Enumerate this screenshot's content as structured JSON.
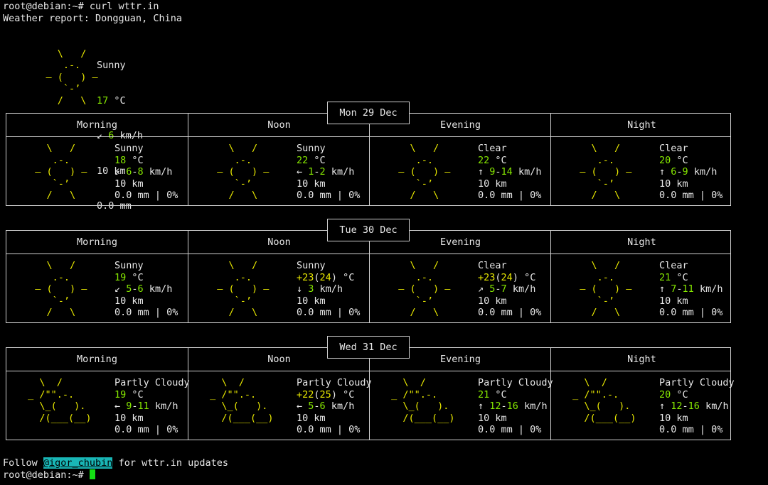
{
  "terminal": {
    "prompt_command": "root@debian:~# curl wttr.in",
    "report_title": "Weather report: Dongguan, China",
    "follow_prefix": "Follow ",
    "follow_handle": "@igor_chubin",
    "follow_suffix": " for wttr.in updates",
    "final_prompt": "root@debian:~# "
  },
  "art": {
    "sunny": [
      "    \\   /    ",
      "     .-.     ",
      "  ― (   ) ―  ",
      "     `-’     ",
      "    /   \\    "
    ],
    "partly_cloudy": [
      "   \\  /      ",
      " _ /\"\".-.    ",
      "   \\_(   ).  ",
      "   /(___(__) ",
      "             "
    ]
  },
  "current": {
    "condition": "Sunny",
    "temp_value": "17",
    "temp_unit": " °C",
    "wind_arrow": "↙ ",
    "wind_value": "6",
    "wind_unit": " km/h",
    "visibility": "10 km",
    "precip": "0.0 mm"
  },
  "periods": [
    "Morning",
    "Noon",
    "Evening",
    "Night"
  ],
  "days": [
    {
      "date": "Mon 29 Dec",
      "cells": [
        {
          "art": "sunny",
          "condition": "Sunny",
          "temp_pre": "",
          "temp_main": "18",
          "temp_mid": "",
          "temp_paren": "",
          "temp_post": "",
          "temp_unit": " °C",
          "wind_arrow": "↙ ",
          "wind_a": "6",
          "wind_sep": "-",
          "wind_b": "8",
          "wind_unit": " km/h",
          "visibility": "10 km",
          "precip": "0.0 mm | 0%"
        },
        {
          "art": "sunny",
          "condition": "Sunny",
          "temp_pre": "",
          "temp_main": "22",
          "temp_mid": "",
          "temp_paren": "",
          "temp_post": "",
          "temp_unit": " °C",
          "wind_arrow": "← ",
          "wind_a": "1",
          "wind_sep": "-",
          "wind_b": "2",
          "wind_unit": " km/h",
          "visibility": "10 km",
          "precip": "0.0 mm | 0%"
        },
        {
          "art": "sunny",
          "condition": "Clear",
          "temp_pre": "",
          "temp_main": "22",
          "temp_mid": "",
          "temp_paren": "",
          "temp_post": "",
          "temp_unit": " °C",
          "wind_arrow": "↑ ",
          "wind_a": "9",
          "wind_sep": "-",
          "wind_b": "14",
          "wind_unit": " km/h",
          "visibility": "10 km",
          "precip": "0.0 mm | 0%"
        },
        {
          "art": "sunny",
          "condition": "Clear",
          "temp_pre": "",
          "temp_main": "20",
          "temp_mid": "",
          "temp_paren": "",
          "temp_post": "",
          "temp_unit": " °C",
          "wind_arrow": "↑ ",
          "wind_a": "6",
          "wind_sep": "-",
          "wind_b": "9",
          "wind_unit": " km/h",
          "visibility": "10 km",
          "precip": "0.0 mm | 0%"
        }
      ]
    },
    {
      "date": "Tue 30 Dec",
      "cells": [
        {
          "art": "sunny",
          "condition": "Sunny",
          "temp_pre": "",
          "temp_main": "19",
          "temp_mid": "",
          "temp_paren": "",
          "temp_post": "",
          "temp_unit": " °C",
          "wind_arrow": "↙ ",
          "wind_a": "5",
          "wind_sep": "-",
          "wind_b": "6",
          "wind_unit": " km/h",
          "visibility": "10 km",
          "precip": "0.0 mm | 0%"
        },
        {
          "art": "sunny",
          "condition": "Sunny",
          "temp_pre": "+",
          "temp_main": "23",
          "temp_mid": "(",
          "temp_paren": "24",
          "temp_post": ")",
          "temp_unit": " °C",
          "wind_arrow": "↓ ",
          "wind_a": "3",
          "wind_sep": "",
          "wind_b": "",
          "wind_unit": " km/h",
          "visibility": "10 km",
          "precip": "0.0 mm | 0%"
        },
        {
          "art": "sunny",
          "condition": "Clear",
          "temp_pre": "+",
          "temp_main": "23",
          "temp_mid": "(",
          "temp_paren": "24",
          "temp_post": ")",
          "temp_unit": " °C",
          "wind_arrow": "↗ ",
          "wind_a": "5",
          "wind_sep": "-",
          "wind_b": "7",
          "wind_unit": " km/h",
          "visibility": "10 km",
          "precip": "0.0 mm | 0%"
        },
        {
          "art": "sunny",
          "condition": "Clear",
          "temp_pre": "",
          "temp_main": "21",
          "temp_mid": "",
          "temp_paren": "",
          "temp_post": "",
          "temp_unit": " °C",
          "wind_arrow": "↑ ",
          "wind_a": "7",
          "wind_sep": "-",
          "wind_b": "11",
          "wind_unit": " km/h",
          "visibility": "10 km",
          "precip": "0.0 mm | 0%"
        }
      ]
    },
    {
      "date": "Wed 31 Dec",
      "cells": [
        {
          "art": "partly_cloudy",
          "condition": "Partly Cloudy",
          "temp_pre": "",
          "temp_main": "19",
          "temp_mid": "",
          "temp_paren": "",
          "temp_post": "",
          "temp_unit": " °C",
          "wind_arrow": "← ",
          "wind_a": "9",
          "wind_sep": "-",
          "wind_b": "11",
          "wind_unit": " km/h",
          "visibility": "10 km",
          "precip": "0.0 mm | 0%"
        },
        {
          "art": "partly_cloudy",
          "condition": "Partly Cloudy",
          "temp_pre": "+",
          "temp_main": "22",
          "temp_mid": "(",
          "temp_paren": "25",
          "temp_post": ")",
          "temp_unit": " °C",
          "wind_arrow": "← ",
          "wind_a": "5",
          "wind_sep": "-",
          "wind_b": "6",
          "wind_unit": " km/h",
          "visibility": "10 km",
          "precip": "0.0 mm | 0%"
        },
        {
          "art": "partly_cloudy",
          "condition": "Partly Cloudy",
          "temp_pre": "",
          "temp_main": "21",
          "temp_mid": "",
          "temp_paren": "",
          "temp_post": "",
          "temp_unit": " °C",
          "wind_arrow": "↑ ",
          "wind_a": "12",
          "wind_sep": "-",
          "wind_b": "16",
          "wind_unit": " km/h",
          "visibility": "10 km",
          "precip": "0.0 mm | 0%"
        },
        {
          "art": "partly_cloudy",
          "condition": "Partly Cloudy",
          "temp_pre": "",
          "temp_main": "20",
          "temp_mid": "",
          "temp_paren": "",
          "temp_post": "",
          "temp_unit": " °C",
          "wind_arrow": "↑ ",
          "wind_a": "12",
          "wind_sep": "-",
          "wind_b": "16",
          "wind_unit": " km/h",
          "visibility": "10 km",
          "precip": "0.0 mm | 0%"
        }
      ]
    }
  ]
}
